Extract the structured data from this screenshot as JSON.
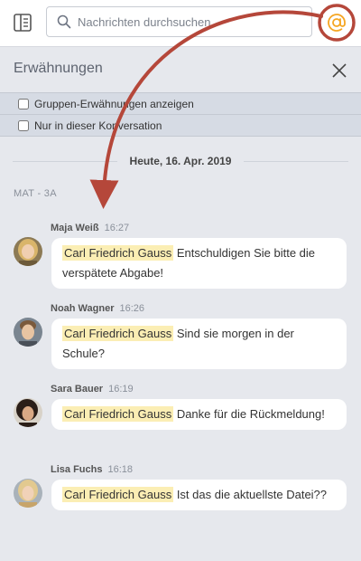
{
  "search": {
    "placeholder": "Nachrichten durchsuchen"
  },
  "panel": {
    "title": "Erwähnungen"
  },
  "filters": [
    {
      "label": "Gruppen-Erwähnungen anzeigen",
      "checked": false
    },
    {
      "label": "Nur in dieser Konversation",
      "checked": false
    }
  ],
  "date_separator": "Heute, 16. Apr. 2019",
  "channel": "MAT - 3A",
  "messages": [
    {
      "author": "Maja Weiß",
      "time": "16:27",
      "mention": "Carl Friedrich Gauss",
      "text": " Entschuldigen Sie bitte die verspätete Abgabe!"
    },
    {
      "author": "Noah Wagner",
      "time": "16:26",
      "mention": "Carl Friedrich Gauss",
      "text": " Sind sie morgen in der Schule?"
    },
    {
      "author": "Sara Bauer",
      "time": "16:19",
      "mention": "Carl Friedrich Gauss",
      "text": " Danke für die Rückmeldung!"
    },
    {
      "author": "Lisa Fuchs",
      "time": "16:18",
      "mention": "Carl Friedrich Gauss",
      "text": " Ist das die aktuellste Datei??"
    }
  ],
  "colors": {
    "accent": "#f5a623",
    "annotation_arrow": "#b5473a",
    "mention_highlight": "#fbeeb4"
  }
}
